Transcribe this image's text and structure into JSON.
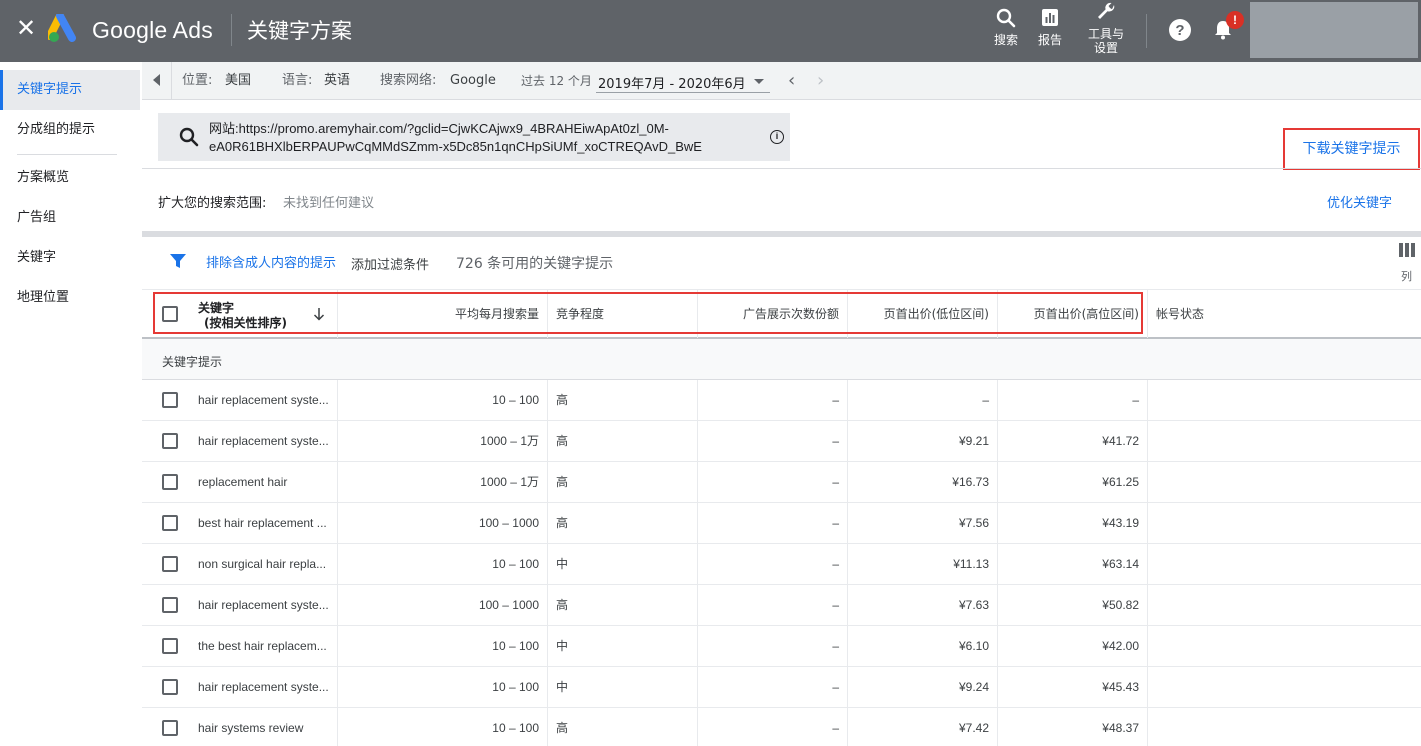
{
  "header": {
    "close_glyph": "✕",
    "brand": "Google Ads",
    "page_title": "关键字方案",
    "actions": [
      {
        "label": "搜索",
        "icon": "search-icon"
      },
      {
        "label": "报告",
        "icon": "reports-icon"
      },
      {
        "label": "工具与",
        "label2": "设置",
        "icon": "wrench-icon"
      }
    ],
    "notification_badge": "!",
    "colors": {
      "bar": "#5f6368",
      "badge": "#d93025"
    }
  },
  "sidebar": {
    "items": [
      {
        "label": "关键字提示",
        "active": true
      },
      {
        "label": "分成组的提示"
      },
      {
        "label": "方案概览"
      },
      {
        "label": "广告组"
      },
      {
        "label": "关键字"
      },
      {
        "label": "地理位置"
      }
    ]
  },
  "filters": {
    "location_label": "位置:",
    "location_value": "美国",
    "language_label": "语言:",
    "language_value": "英语",
    "network_label": "搜索网络:",
    "network_value": "Google",
    "period_label": "过去 12 个月",
    "date_range": "2019年7月 - 2020年6月",
    "prev": "‹",
    "next": "›"
  },
  "url_box": {
    "label": "网站:",
    "url_line1": "https://promo.aremyhair.com/?gclid=CjwKCAjwx9_4BRAHEiwApAt0zl_0M-",
    "url_line2": "eA0R61BHXlbERPAUPwCqMMdSZmm-x5Dc85n1qnCHpSiUMf_xoCTREQAvD_BwE",
    "info_glyph": "i"
  },
  "download_link": "下载关键字提示",
  "broaden": {
    "label": "扩大您的搜索范围:",
    "value": "未找到任何建议"
  },
  "refine_link": "优化关键字",
  "toolbar": {
    "exclude_adult": "排除含成人内容的提示",
    "add_filter": "添加过滤条件",
    "count_text": "726 条可用的关键字提示",
    "columns_label": "列"
  },
  "table": {
    "headers": {
      "keyword": "关键字",
      "keyword_sub": "(按相关性排序)",
      "searches": "平均每月搜索量",
      "competition": "竞争程度",
      "impression_share": "广告展示次数份额",
      "bid_low": "页首出价(低位区间)",
      "bid_high": "页首出价(高位区间)",
      "status": "帐号状态"
    },
    "group_label": "关键字提示",
    "rows": [
      {
        "keyword": "hair replacement syste...",
        "searches": "10 – 100",
        "competition": "高",
        "share": "–",
        "low": "–",
        "high": "–"
      },
      {
        "keyword": "hair replacement syste...",
        "searches": "1000 – 1万",
        "competition": "高",
        "share": "–",
        "low": "¥9.21",
        "high": "¥41.72"
      },
      {
        "keyword": "replacement hair",
        "searches": "1000 – 1万",
        "competition": "高",
        "share": "–",
        "low": "¥16.73",
        "high": "¥61.25"
      },
      {
        "keyword": "best hair replacement ...",
        "searches": "100 – 1000",
        "competition": "高",
        "share": "–",
        "low": "¥7.56",
        "high": "¥43.19"
      },
      {
        "keyword": "non surgical hair repla...",
        "searches": "10 – 100",
        "competition": "中",
        "share": "–",
        "low": "¥11.13",
        "high": "¥63.14"
      },
      {
        "keyword": "hair replacement syste...",
        "searches": "100 – 1000",
        "competition": "高",
        "share": "–",
        "low": "¥7.63",
        "high": "¥50.82"
      },
      {
        "keyword": "the best hair replacem...",
        "searches": "10 – 100",
        "competition": "中",
        "share": "–",
        "low": "¥6.10",
        "high": "¥42.00"
      },
      {
        "keyword": "hair replacement syste...",
        "searches": "10 – 100",
        "competition": "中",
        "share": "–",
        "low": "¥9.24",
        "high": "¥45.43"
      },
      {
        "keyword": "hair systems review",
        "searches": "10 – 100",
        "competition": "高",
        "share": "–",
        "low": "¥7.42",
        "high": "¥48.37"
      }
    ]
  },
  "accent_color": "#1a73e8",
  "highlight_color": "#e53935"
}
